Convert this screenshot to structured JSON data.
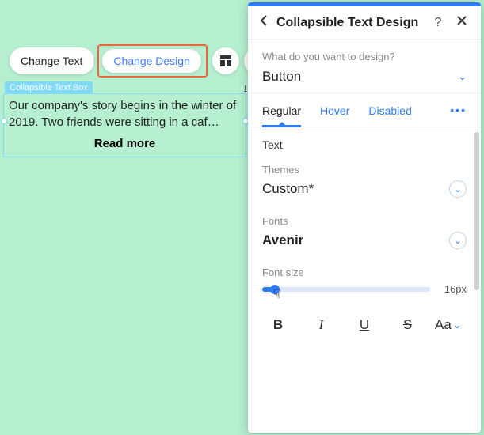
{
  "toolbar": {
    "change_text": "Change Text",
    "change_design": "Change Design"
  },
  "element": {
    "label": "Collapsible Text Box",
    "body": "Our company's story begins in the winter of 2019. Two friends were sitting in a caf…",
    "read_more": "Read more"
  },
  "panel": {
    "title": "Collapsible Text Design",
    "question_label": "What do you want to design?",
    "design_target": "Button",
    "tabs": {
      "regular": "Regular",
      "hover": "Hover",
      "disabled": "Disabled"
    },
    "text_group": "Text",
    "themes": {
      "label": "Themes",
      "value": "Custom*"
    },
    "fonts": {
      "label": "Fonts",
      "value": "Avenir"
    },
    "font_size": {
      "label": "Font size",
      "value": "16px"
    },
    "format": {
      "bold": "B",
      "italic": "I",
      "underline": "U",
      "strike": "S",
      "case": "Aa"
    }
  }
}
